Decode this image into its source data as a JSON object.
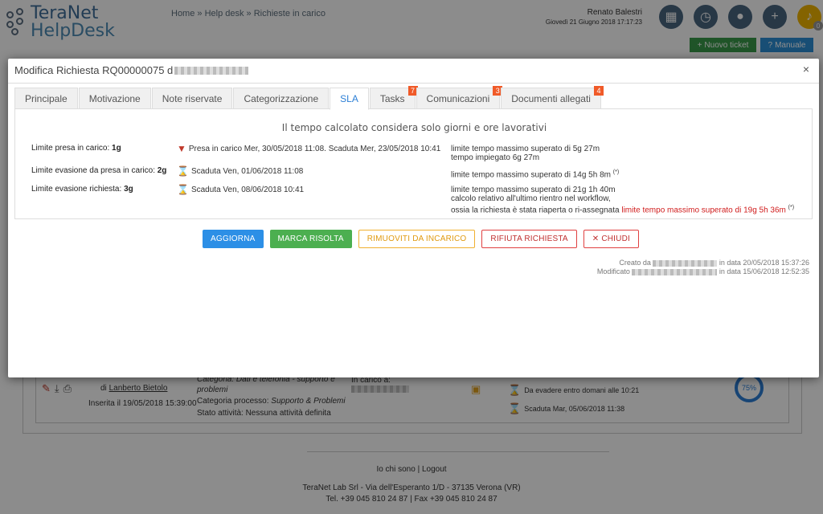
{
  "app": {
    "logo_line1": "TeraNet",
    "logo_line2": "HelpDesk"
  },
  "breadcrumb": "Home » Help desk » Richieste in carico",
  "user": {
    "name": "Renato Balestri",
    "date": "Giovedì 21 Giugno 2018 17:17:23"
  },
  "header_buttons": {
    "new_ticket": "Nuovo ticket",
    "manual": "Manuale",
    "notification_count": "0"
  },
  "background": {
    "author_prefix": "di",
    "author": "Lanberto Bietolo",
    "inserted": "Inserita il 19/05/2018 15:39:00",
    "category": "Categoria: Dati e telefonia - supporto e problemi",
    "process_label": "Categoria processo:",
    "process_value": "Supporto & Problemi",
    "activity": "Stato attività:  Nessuna attività definita",
    "in_charge": "In carico a:",
    "due1": "Da evadere entro domani alle 10:21",
    "due2": "Scaduta Mar, 05/06/2018 11:38",
    "progress": "75%"
  },
  "footer": {
    "links": "Io chi sono | Logout",
    "address1": "TeraNet Lab Srl - Via dell'Esperanto 1/D - 37135 Verona (VR)",
    "address2": "Tel. +39 045 810 24 87 | Fax +39 045 810 24 87"
  },
  "modal": {
    "title": "Modifica Richiesta RQ00000075 d",
    "close": "×",
    "tabs": [
      {
        "label": "Principale"
      },
      {
        "label": "Motivazione"
      },
      {
        "label": "Note riservate"
      },
      {
        "label": "Categorizzazione"
      },
      {
        "label": "SLA"
      },
      {
        "label": "Tasks",
        "badge": "7"
      },
      {
        "label": "Comunicazioni",
        "badge": "3"
      },
      {
        "label": "Documenti allegati",
        "badge": "4"
      }
    ],
    "sla": {
      "header": "Il tempo calcolato considera solo giorni e ore lavorativi",
      "rows": [
        {
          "label": "Limite presa in carico: ",
          "value": "1g",
          "status": "Presa in carico Mer, 30/05/2018 11:08. Scaduta Mer, 23/05/2018 10:41",
          "detail1": "limite tempo massimo superato di 5g 27m",
          "detail2": "tempo impiegato 6g 27m"
        },
        {
          "label": "Limite evasione da presa in carico: ",
          "value": "2g",
          "status": "Scaduta Ven, 01/06/2018 11:08",
          "detail1": "limite tempo massimo superato di 14g 5h 8m ",
          "detail_mark": "(*)"
        },
        {
          "label": "Limite evasione richiesta: ",
          "value": "3g",
          "status": "Scaduta Ven, 08/06/2018 10:41",
          "detail1": "limite tempo massimo superato di 21g 1h 40m",
          "detail2": "calcolo relativo all'ultimo rientro nel workflow,",
          "detail3": "ossia la richiesta è stata riaperta o ri-assegnata ",
          "detail3_red": "limite tempo massimo superato di 19g 5h 36m",
          "detail_mark": "(*)"
        }
      ]
    },
    "actions": {
      "update": "AGGIORNA",
      "resolve": "MARCA RISOLTA",
      "remove": "RIMUOVITI DA INCARICO",
      "reject": "RIFIUTA RICHIESTA",
      "close": "CHIUDI"
    },
    "meta": {
      "created_prefix": "Creato da",
      "created_suffix": "in data 20/05/2018 15:37:26",
      "modified_prefix": "Modificato",
      "modified_suffix": "in data 15/06/2018 12:52:35"
    }
  }
}
